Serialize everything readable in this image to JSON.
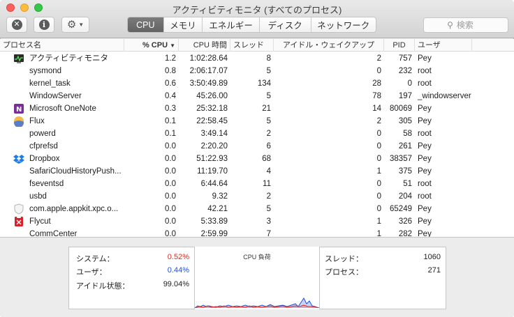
{
  "window": {
    "title": "アクティビティモニタ (すべてのプロセス)"
  },
  "toolbar": {
    "tabs": [
      {
        "label": "CPU",
        "active": true
      },
      {
        "label": "メモリ",
        "active": false
      },
      {
        "label": "エネルギー",
        "active": false
      },
      {
        "label": "ディスク",
        "active": false
      },
      {
        "label": "ネットワーク",
        "active": false
      }
    ],
    "search_placeholder": "検索",
    "icons": {
      "stop": "stop-process-icon",
      "info": "info-icon",
      "gear": "gear-icon"
    }
  },
  "table": {
    "headers": {
      "name": "プロセス名",
      "cpu": "% CPU",
      "cpu_time": "CPU 時間",
      "threads": "スレッド",
      "idle_wakeups": "アイドル・ウェイクアップ",
      "pid": "PID",
      "user": "ユーザ"
    },
    "rows": [
      {
        "icon": "activity-monitor",
        "name": "アクティビティモニタ",
        "cpu": "1.2",
        "time": "1:02:28.64",
        "threads": "8",
        "idle": "2",
        "pid": "757",
        "user": "Pey"
      },
      {
        "icon": "",
        "name": "sysmond",
        "cpu": "0.8",
        "time": "2:06:17.07",
        "threads": "5",
        "idle": "0",
        "pid": "232",
        "user": "root"
      },
      {
        "icon": "",
        "name": "kernel_task",
        "cpu": "0.6",
        "time": "3:50:49.89",
        "threads": "134",
        "idle": "28",
        "pid": "0",
        "user": "root"
      },
      {
        "icon": "",
        "name": "WindowServer",
        "cpu": "0.4",
        "time": "45:26.00",
        "threads": "5",
        "idle": "78",
        "pid": "197",
        "user": "_windowserver"
      },
      {
        "icon": "onenote",
        "name": "Microsoft OneNote",
        "cpu": "0.3",
        "time": "25:32.18",
        "threads": "21",
        "idle": "14",
        "pid": "80069",
        "user": "Pey"
      },
      {
        "icon": "flux",
        "name": "Flux",
        "cpu": "0.1",
        "time": "22:58.45",
        "threads": "5",
        "idle": "2",
        "pid": "305",
        "user": "Pey"
      },
      {
        "icon": "",
        "name": "powerd",
        "cpu": "0.1",
        "time": "3:49.14",
        "threads": "2",
        "idle": "0",
        "pid": "58",
        "user": "root"
      },
      {
        "icon": "",
        "name": "cfprefsd",
        "cpu": "0.0",
        "time": "2:20.20",
        "threads": "6",
        "idle": "0",
        "pid": "261",
        "user": "Pey"
      },
      {
        "icon": "dropbox",
        "name": "Dropbox",
        "cpu": "0.0",
        "time": "51:22.93",
        "threads": "68",
        "idle": "0",
        "pid": "38357",
        "user": "Pey"
      },
      {
        "icon": "",
        "name": "SafariCloudHistoryPush...",
        "cpu": "0.0",
        "time": "11:19.70",
        "threads": "4",
        "idle": "1",
        "pid": "375",
        "user": "Pey"
      },
      {
        "icon": "",
        "name": "fseventsd",
        "cpu": "0.0",
        "time": "6:44.64",
        "threads": "11",
        "idle": "0",
        "pid": "51",
        "user": "root"
      },
      {
        "icon": "",
        "name": "usbd",
        "cpu": "0.0",
        "time": "9.32",
        "threads": "2",
        "idle": "0",
        "pid": "204",
        "user": "root"
      },
      {
        "icon": "shield",
        "name": "com.apple.appkit.xpc.o...",
        "cpu": "0.0",
        "time": "42.21",
        "threads": "5",
        "idle": "0",
        "pid": "65249",
        "user": "Pey"
      },
      {
        "icon": "flycut",
        "name": "Flycut",
        "cpu": "0.0",
        "time": "5:33.89",
        "threads": "3",
        "idle": "1",
        "pid": "326",
        "user": "Pey"
      },
      {
        "icon": "",
        "name": "CommCenter",
        "cpu": "0.0",
        "time": "2:59.99",
        "threads": "7",
        "idle": "1",
        "pid": "282",
        "user": "Pey"
      }
    ]
  },
  "summary": {
    "system_label": "システム：",
    "system_value": "0.52%",
    "user_label": "ユーザ：",
    "user_value": "0.44%",
    "idle_label": "アイドル状態：",
    "idle_value": "99.04%",
    "graph_title": "CPU 負荷",
    "threads_label": "スレッド：",
    "threads_value": "1060",
    "processes_label": "プロセス：",
    "processes_value": "271",
    "colors": {
      "system": "#e2281d",
      "user": "#1f4ee0"
    }
  }
}
